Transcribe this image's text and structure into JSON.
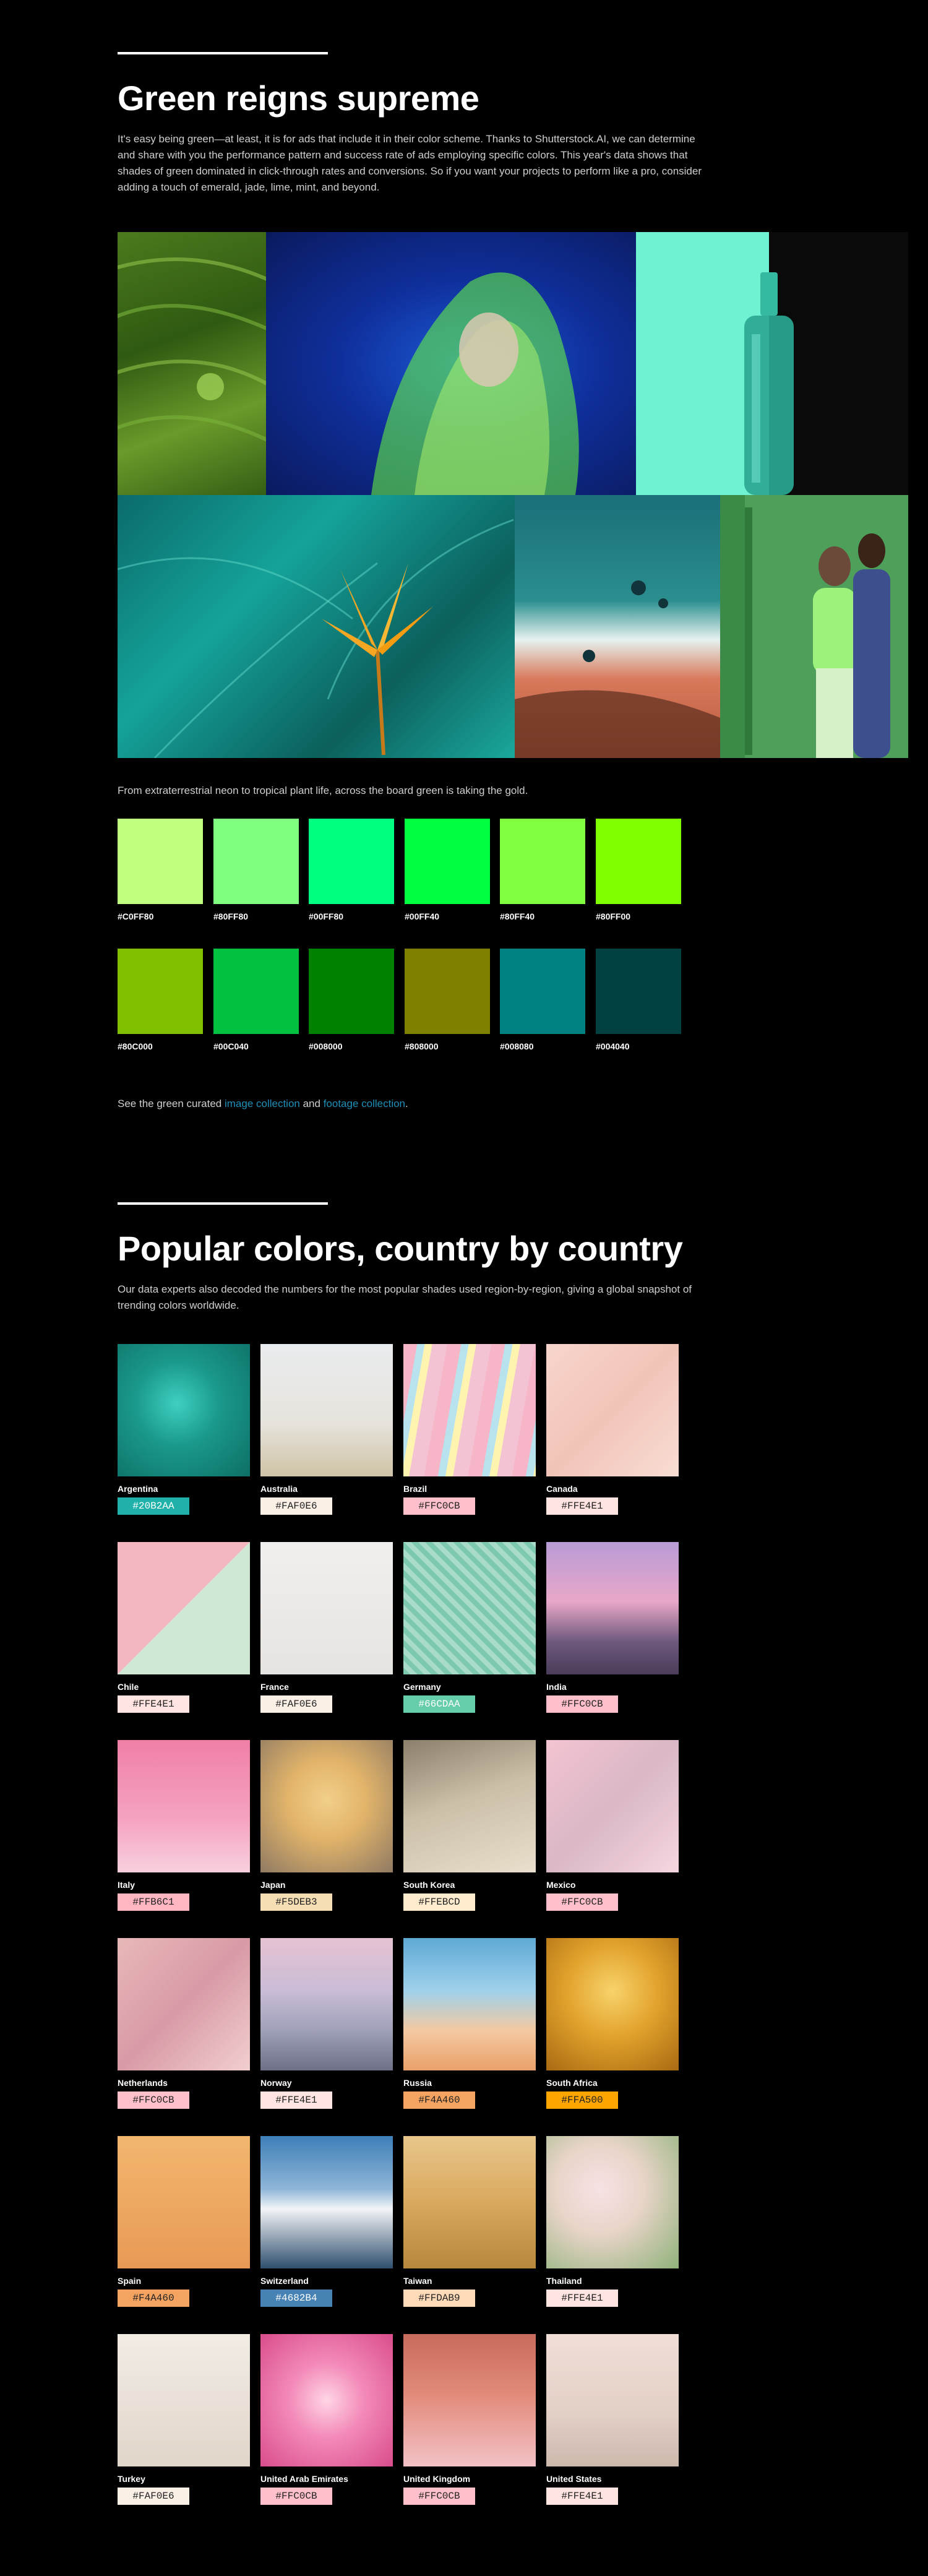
{
  "green": {
    "title": "Green reigns supreme",
    "paragraph": "It's easy being green—at least, it is for ads that include it in their color scheme. Thanks to Shutterstock.AI, we can determine and share with you the performance pattern and success rate of ads employing specific colors. This year's data shows that shades of green dominated in click-through rates and conversions. So if you want your projects to perform like a pro, consider adding a touch of emerald, jade, lime, mint, and beyond.",
    "caption": "From extraterrestrial neon to tropical plant life, across the board green is taking the gold.",
    "swatches_row1": [
      "#C0FF80",
      "#80FF80",
      "#00FF80",
      "#00FF40",
      "#80FF40",
      "#80FF00"
    ],
    "swatches_row2": [
      "#80C000",
      "#00C040",
      "#008000",
      "#808000",
      "#008080",
      "#004040"
    ],
    "see_prefix": "See the green curated ",
    "image_link": "image collection",
    "and_text": " and ",
    "footage_link": "footage collection",
    "period": "."
  },
  "popular": {
    "title": "Popular colors, country by country",
    "paragraph": "Our data experts also decoded the numbers for the most popular shades used region-by-region, giving a global snapshot of trending colors worldwide.",
    "countries": [
      {
        "name": "Argentina",
        "hex": "#20B2AA",
        "textColor": "#ffffff"
      },
      {
        "name": "Australia",
        "hex": "#FAF0E6",
        "textColor": "#222222"
      },
      {
        "name": "Brazil",
        "hex": "#FFC0CB",
        "textColor": "#222222"
      },
      {
        "name": "Canada",
        "hex": "#FFE4E1",
        "textColor": "#222222"
      },
      {
        "name": "Chile",
        "hex": "#FFE4E1",
        "textColor": "#222222"
      },
      {
        "name": "France",
        "hex": "#FAF0E6",
        "textColor": "#222222"
      },
      {
        "name": "Germany",
        "hex": "#66CDAA",
        "textColor": "#ffffff"
      },
      {
        "name": "India",
        "hex": "#FFC0CB",
        "textColor": "#222222"
      },
      {
        "name": "Italy",
        "hex": "#FFB6C1",
        "textColor": "#222222"
      },
      {
        "name": "Japan",
        "hex": "#F5DEB3",
        "textColor": "#222222"
      },
      {
        "name": "South Korea",
        "hex": "#FFEBCD",
        "textColor": "#222222"
      },
      {
        "name": "Mexico",
        "hex": "#FFC0CB",
        "textColor": "#222222"
      },
      {
        "name": "Netherlands",
        "hex": "#FFC0CB",
        "textColor": "#222222"
      },
      {
        "name": "Norway",
        "hex": "#FFE4E1",
        "textColor": "#222222"
      },
      {
        "name": "Russia",
        "hex": "#F4A460",
        "textColor": "#222222"
      },
      {
        "name": "South Africa",
        "hex": "#FFA500",
        "textColor": "#222222"
      },
      {
        "name": "Spain",
        "hex": "#F4A460",
        "textColor": "#222222"
      },
      {
        "name": "Switzerland",
        "hex": "#4682B4",
        "textColor": "#ffffff"
      },
      {
        "name": "Taiwan",
        "hex": "#FFDAB9",
        "textColor": "#222222"
      },
      {
        "name": "Thailand",
        "hex": "#FFE4E1",
        "textColor": "#222222"
      },
      {
        "name": "Turkey",
        "hex": "#FAF0E6",
        "textColor": "#222222"
      },
      {
        "name": "United Arab Emirates",
        "hex": "#FFC0CB",
        "textColor": "#222222"
      },
      {
        "name": "United Kingdom",
        "hex": "#FFC0CB",
        "textColor": "#222222"
      },
      {
        "name": "United States",
        "hex": "#FFE4E1",
        "textColor": "#222222"
      }
    ]
  },
  "colors": {
    "background": "#000000",
    "link": "#1E8FB8"
  }
}
